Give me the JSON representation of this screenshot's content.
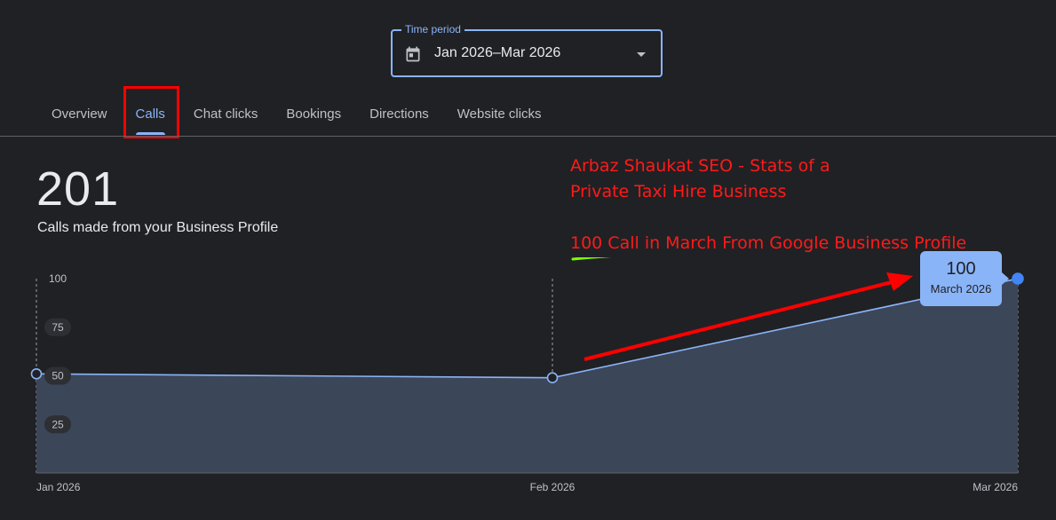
{
  "time_period": {
    "label": "Time period",
    "value": "Jan 2026–Mar 2026",
    "icon": "calendar-icon"
  },
  "tabs": [
    {
      "label": "Overview",
      "active": false
    },
    {
      "label": "Calls",
      "active": true
    },
    {
      "label": "Chat clicks",
      "active": false
    },
    {
      "label": "Bookings",
      "active": false
    },
    {
      "label": "Directions",
      "active": false
    },
    {
      "label": "Website clicks",
      "active": false
    }
  ],
  "metric": {
    "value": "201",
    "label": "Calls made from your Business Profile"
  },
  "annotations": {
    "line1": "Arbaz Shaukat SEO - Stats of a",
    "line2": "Private Taxi Hire Business",
    "line3_underlined": "100 Call",
    "line3_rest": " in March From Google Business Profile",
    "text_color": "#ff1a1a",
    "underline_color": "#7cfc00"
  },
  "tooltip": {
    "value": "100",
    "label": "March 2026"
  },
  "colors": {
    "background": "#202124",
    "accent": "#8ab4f8",
    "area_fill": "#3c4659",
    "selected_point": "#4285f4",
    "highlight_box": "#ff0000"
  },
  "chart_data": {
    "type": "area",
    "categories": [
      "Jan 2026",
      "Feb 2026",
      "Mar 2026"
    ],
    "values": [
      51,
      49,
      100
    ],
    "y_ticks": [
      25,
      50,
      75,
      100
    ],
    "ylim": [
      0,
      100
    ],
    "grid": "vertical dashed lines at each month"
  }
}
